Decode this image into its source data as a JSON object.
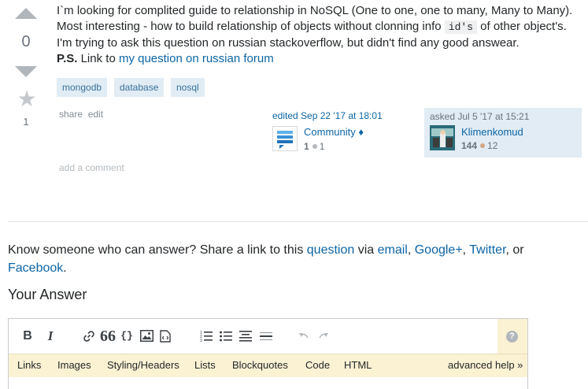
{
  "vote": {
    "count": "0",
    "favorite_count": "1"
  },
  "post": {
    "paragraph1_part1": "I`m looking for complited guide to relationship in NoSQL (One to one, one to many, Many to Many). Most interesting - how to build relationship of objects without clonning info ",
    "paragraph1_code": "id's",
    "paragraph1_part2": " of other object's. I'm trying to ask this question on russian stackoverflow, but didn't find any good answear.",
    "ps_label": "P.S.",
    "ps_text": " Link to ",
    "ps_link": "my question on russian forum"
  },
  "tags": [
    "mongodb",
    "database",
    "nosql"
  ],
  "post_menu": {
    "share": "share",
    "edit": "edit"
  },
  "edited": {
    "action": "edited Sep 22 '17 at 18:01",
    "user": "Community",
    "diamond": "♦",
    "rep": "1",
    "bronze": "1"
  },
  "asked": {
    "action": "asked Jul 5 '17 at 15:21",
    "user": "Klimenkomud",
    "rep": "144",
    "bronze": "12"
  },
  "add_comment": "add a comment",
  "share_prompt": {
    "lead": "Know someone who can answer? Share a link to this ",
    "question": "question",
    "via": " via ",
    "email": "email",
    "sep1": ", ",
    "google": "Google+",
    "sep2": ", ",
    "twitter": "Twitter",
    "or": ", or",
    "facebook": "Facebook",
    "end": "."
  },
  "your_answer": "Your Answer",
  "editor": {
    "toolbar": {
      "bold": "B",
      "italic": "I",
      "quote": "66",
      "code": "{}",
      "help": "?"
    },
    "help_items": [
      "Links",
      "Images",
      "Styling/Headers",
      "Lists",
      "Blockquotes",
      "Code",
      "HTML"
    ],
    "advanced_help": "advanced help »"
  },
  "colors": {
    "link": "#0c65a5",
    "tag_bg": "#e1ecf4",
    "tag_text": "#39739d",
    "owner_bg": "#e1ecf4",
    "bronze": "#d1a684",
    "help_bg": "#fbf2d4"
  }
}
